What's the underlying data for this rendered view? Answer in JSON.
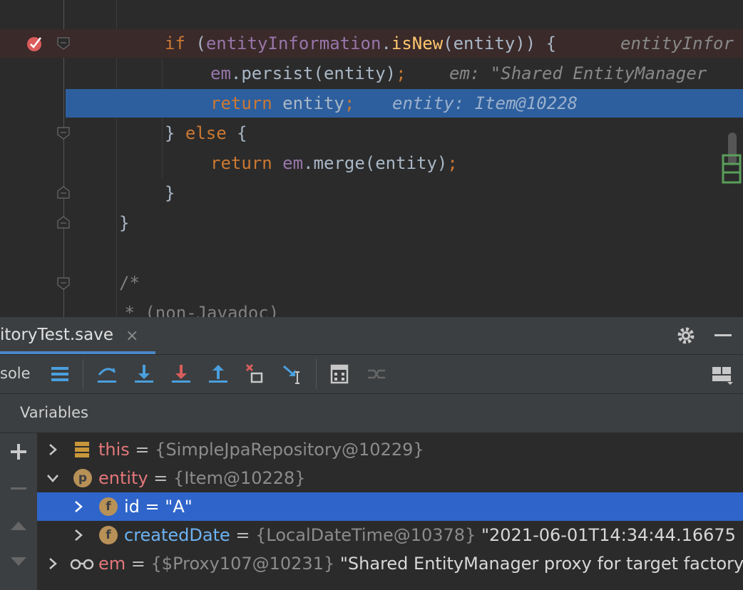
{
  "editor": {
    "lines": {
      "l1": {
        "kw": "if",
        "open": " (",
        "fld": "entityInformation",
        "dot": ".",
        "fn": "isNew",
        "rest": "(entity)) {",
        "hint": "entityInfor"
      },
      "l2": {
        "fld": "em",
        "dot": ".",
        "fn": "persist",
        "rest": "(entity)",
        "semi": ";",
        "hint": "em: \"Shared EntityManager"
      },
      "l3": {
        "kw": "return",
        "rest": " entity",
        "semi": ";",
        "hint": "entity: Item@10228"
      },
      "l4": {
        "brace": "} ",
        "kw": "else",
        "rest": " {"
      },
      "l5": {
        "kw": "return",
        "fld": " em",
        "dot": ".",
        "fn": "merge",
        "rest": "(entity)",
        "semi": ";"
      },
      "l6": {
        "text": "}"
      },
      "l7": {
        "text": "}"
      },
      "l8": {
        "text": "/*"
      },
      "l9": {
        "text": " * (non-Javadoc)"
      }
    }
  },
  "debug_panel": {
    "tab_label": "itoryTest.save",
    "tab_close": "×",
    "console_label": "sole",
    "variables_title": "Variables",
    "rows": [
      {
        "name": "this",
        "eq": " = ",
        "value": "{SimpleJpaRepository@10229}",
        "extra": ""
      },
      {
        "name": "entity",
        "badge": "p",
        "eq": " = ",
        "value": "{Item@10228}",
        "extra": ""
      },
      {
        "name": "id",
        "badge": "f",
        "eq": " = ",
        "value": "\"A\"",
        "extra": ""
      },
      {
        "name": "createdDate",
        "badge": "f",
        "eq": " = ",
        "value": "{LocalDateTime@10378}",
        "extra": " \"2021-06-01T14:34:44.16675"
      },
      {
        "name": "em",
        "eq": " = ",
        "value": "{$Proxy107@10231}",
        "extra": " \"Shared EntityManager proxy for target factory"
      }
    ]
  },
  "colors": {
    "execution_line": "#2d5f9e",
    "selected_row": "#2f65ca",
    "keyword": "#cc7832",
    "field": "#9876aa",
    "method": "#ffc66d"
  }
}
